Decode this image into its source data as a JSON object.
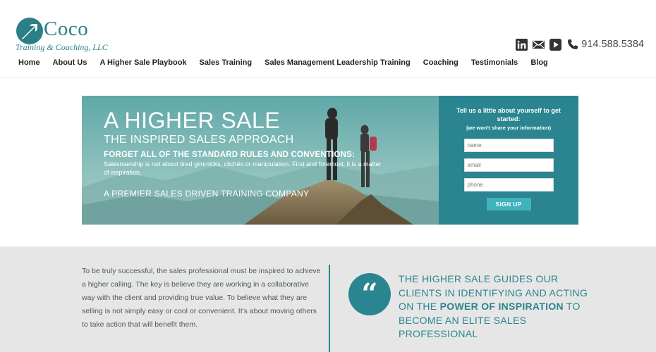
{
  "brand": {
    "name": "Coco",
    "tagline": "Training & Coaching, LLC",
    "color": "#2b7f87"
  },
  "contact": {
    "icons": [
      "linkedin-icon",
      "mail-icon",
      "youtube-icon",
      "phone-icon"
    ],
    "phone": "914.588.5384"
  },
  "nav": {
    "items": [
      "Home",
      "About Us",
      "A Higher Sale Playbook",
      "Sales Training",
      "Sales Management Leadership Training",
      "Coaching",
      "Testimonials",
      "Blog"
    ]
  },
  "hero": {
    "title": "A HIGHER SALE",
    "subtitle": "THE INSPIRED SALES APPROACH",
    "rule": "FORGET ALL OF THE STANDARD RULES AND CONVENTIONS:",
    "body": "Salesmanship is not about tired gimmicks, clichés or manipulation. First and foremost, it is a matter of inspiration.",
    "tagline": "A PREMIER SALES DRIVEN TRAINING COMPANY"
  },
  "form": {
    "title": "Tell us a little about yourself to get started:",
    "note": "(we won't share your information)",
    "name_placeholder": "name",
    "email_placeholder": "email",
    "phone_placeholder": "phone",
    "submit_label": "SIGN UP"
  },
  "intro": {
    "text": "To be truly successful, the sales professional must be inspired to achieve a higher calling. The key is believe they are working in a collaborative way with the client and providing true value. To believe what they are selling is not simply easy or cool or convenient. It's about moving others to take action that will benefit them."
  },
  "quote": {
    "mark": "“",
    "part1": "THE HIGHER SALE GUIDES OUR CLIENTS IN IDENTIFYING AND ACTING ON THE ",
    "emphasis": "POWER OF INSPIRATION",
    "part2": " TO BECOME AN ELITE SALES PROFESSIONAL"
  },
  "colors": {
    "accent": "#2a8590",
    "button": "#40b3bd",
    "band": "#e6e6e6"
  }
}
